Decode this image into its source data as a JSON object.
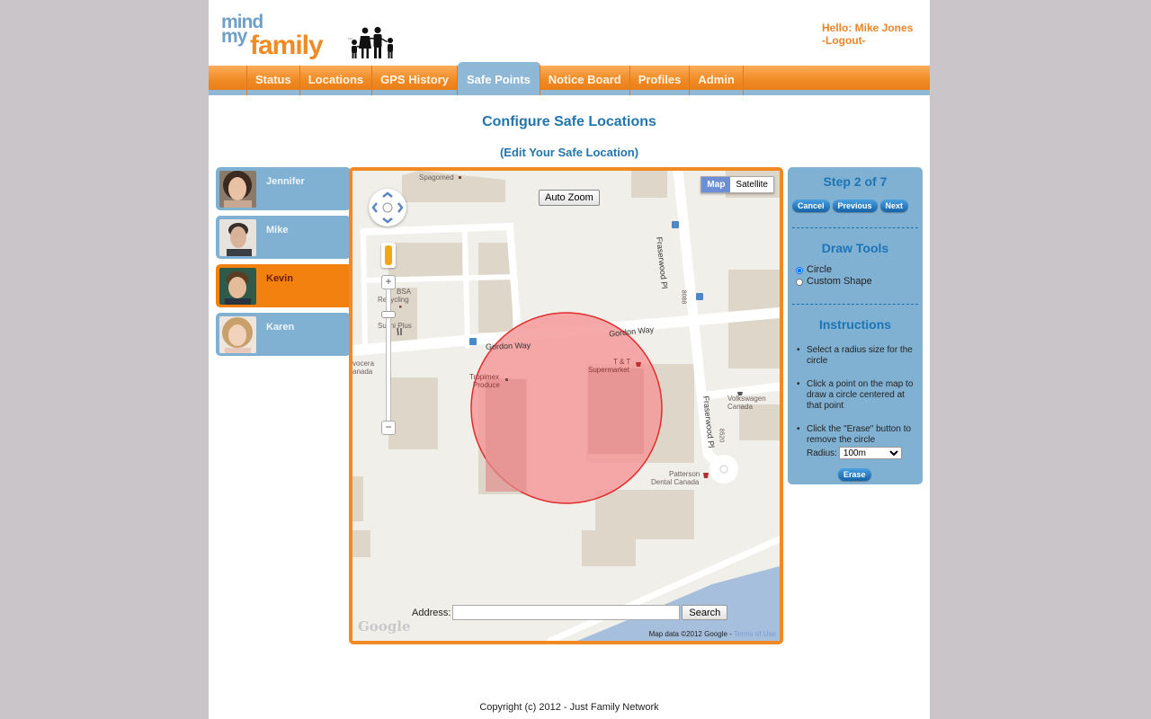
{
  "header": {
    "logo": {
      "line1": "mind",
      "line2": "my",
      "line3": "family",
      "tm": "™"
    },
    "greeting": "Hello: Mike Jones",
    "logout_label": "-Logout-"
  },
  "nav": {
    "items": [
      {
        "label": "Status"
      },
      {
        "label": "Locations"
      },
      {
        "label": "GPS History"
      },
      {
        "label": "Safe Points",
        "active": true
      },
      {
        "label": "Notice Board"
      },
      {
        "label": "Profiles"
      },
      {
        "label": "Admin"
      }
    ]
  },
  "page": {
    "title": "Configure Safe Locations",
    "subtitle": "(Edit Your Safe Location)"
  },
  "profiles": [
    {
      "name": "Jennifer"
    },
    {
      "name": "Mike"
    },
    {
      "name": "Kevin",
      "active": true
    },
    {
      "name": "Karen"
    }
  ],
  "map": {
    "map_type": {
      "map": "Map",
      "satellite": "Satellite",
      "selected": "Map"
    },
    "auto_zoom_label": "Auto Zoom",
    "labels": {
      "spagomed": "Spagomed",
      "bsa": "BSA",
      "recycling": "Recycling",
      "sushi": "Sushi Plus",
      "vocera1": "vocera",
      "vocera2": "anada",
      "tropimex1": "Tropimex",
      "tropimex2": "Produce",
      "tt1": "T & T",
      "tt2": "Supermarket",
      "vw1": "Volkswagen",
      "vw2": "Canada",
      "patterson1": "Patterson",
      "patterson2": "Dental Canada",
      "num1": "8088",
      "num2": "8520"
    },
    "streets": {
      "gordon1": "Gordon Way",
      "gordon2": "Gordon Way",
      "fraserwood1": "Fraserwood Pl",
      "fraserwood2": "Fraserwood Pl"
    },
    "address_label": "Address:",
    "address_value": "",
    "address_placeholder": "",
    "search_label": "Search",
    "google_logo": "Google",
    "attribution": "Map data ©2012 Google - ",
    "terms_label": "Terms of Use",
    "colors": {
      "circle_fill": "#f59a9a",
      "circle_stroke": "#e02c2c",
      "water": "#a6bfdd"
    }
  },
  "panel": {
    "step_label": "Step 2 of 7",
    "buttons": {
      "cancel": "Cancel",
      "previous": "Previous",
      "next": "Next"
    },
    "draw_tools_title": "Draw Tools",
    "draw_options": [
      {
        "label": "Circle",
        "checked": true
      },
      {
        "label": "Custom Shape",
        "checked": false
      }
    ],
    "instructions_title": "Instructions",
    "instructions": [
      "Select a radius size for the circle",
      "Click a point on the map to draw a circle centered at that point",
      "Click the \"Erase\" button to remove the circle"
    ],
    "radius_label": "Radius:",
    "radius_value": "100m",
    "erase_label": "Erase"
  },
  "footer": {
    "copyright": "Copyright (c) 2012 - Just Family Network"
  },
  "colors": {
    "orange": "#f08a24",
    "blue_panel": "#80b1d3",
    "title_blue": "#2275ad"
  }
}
